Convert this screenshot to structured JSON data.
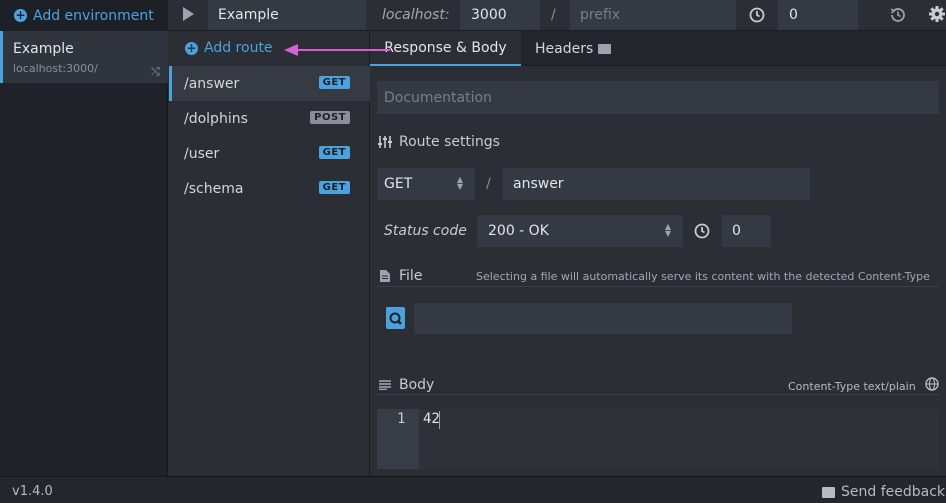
{
  "environments": {
    "add_label": "Add environment",
    "items": [
      {
        "name": "Example",
        "host": "localhost:3000/"
      }
    ]
  },
  "header": {
    "env_title": "Example",
    "host_label": "localhost:",
    "port": "3000",
    "slash": "/",
    "prefix_placeholder": "prefix",
    "latency": "0"
  },
  "routes": {
    "add_label": "Add route",
    "items": [
      {
        "path": "/answer",
        "method": "GET"
      },
      {
        "path": "/dolphins",
        "method": "POST"
      },
      {
        "path": "/user",
        "method": "GET"
      },
      {
        "path": "/schema",
        "method": "GET"
      }
    ]
  },
  "tabs": {
    "response": "Response & Body",
    "headers": "Headers"
  },
  "route_settings": {
    "doc_placeholder": "Documentation",
    "title": "Route settings",
    "method": "GET",
    "slash": "/",
    "path": "answer",
    "status_label": "Status code",
    "status_value": "200 - OK",
    "latency": "0"
  },
  "file": {
    "title": "File",
    "hint": "Selecting a file will automatically serve its content with the detected Content-Type"
  },
  "body": {
    "title": "Body",
    "content_type": "Content-Type text/plain",
    "line_number": "1",
    "code": "42"
  },
  "footer": {
    "version": "v1.4.0",
    "feedback": "Send feedback"
  },
  "colors": {
    "accent": "#4aa3df",
    "annotation_arrow": "#d65fd6",
    "background": "#2b2e35"
  }
}
